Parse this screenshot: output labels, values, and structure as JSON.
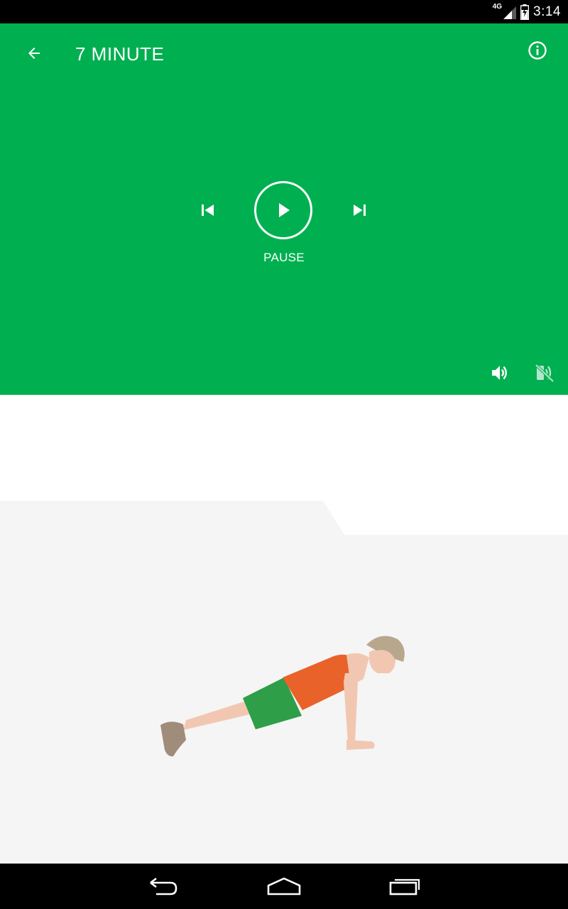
{
  "status_bar": {
    "network": "4G",
    "time": "3:14"
  },
  "header": {
    "title": "7 MINUTE",
    "back_icon": "arrow-back-icon",
    "info_icon": "info-icon"
  },
  "player": {
    "prev_icon": "skip-previous-icon",
    "play_icon": "play-icon",
    "next_icon": "skip-next-icon",
    "state_label": "PAUSE",
    "volume_icon": "volume-up-icon",
    "voice_icon": "voice-off-icon"
  },
  "exercise": {
    "illustration": "push-up-figure"
  },
  "nav_bar": {
    "back_icon": "nav-back-icon",
    "home_icon": "nav-home-icon",
    "recents_icon": "nav-recents-icon"
  },
  "colors": {
    "accent": "#00b050",
    "shirt": "#e8622a",
    "shorts": "#2e9e48",
    "skin": "#f2c7b2",
    "hair": "#b9a78d",
    "shoe": "#a08c7a",
    "floor": "#f5f5f5"
  }
}
